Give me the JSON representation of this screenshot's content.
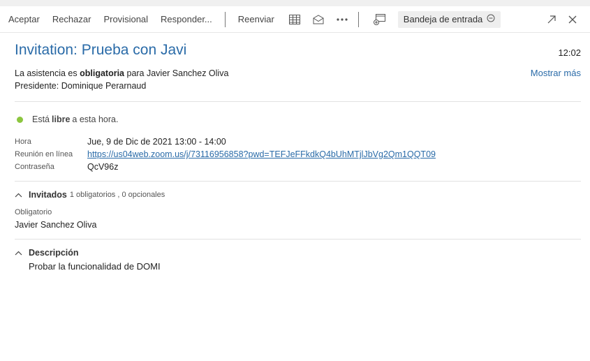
{
  "toolbar": {
    "accept": "Aceptar",
    "reject": "Rechazar",
    "tentative": "Provisional",
    "reply": "Responder...",
    "forward": "Reenviar",
    "folder": "Bandeja de entrada"
  },
  "message": {
    "title": "Invitation: Prueba con Javi",
    "time": "12:02",
    "attendance_prefix": "La asistencia es ",
    "attendance_bold": "obligatoria",
    "attendance_suffix": " para Javier Sanchez Oliva",
    "chair_label": "Presidente: ",
    "chair_name": "Dominique Perarnaud",
    "show_more": "Mostrar más"
  },
  "availability": {
    "prefix": "Está ",
    "bold": "libre",
    "suffix": " a esta hora.",
    "color": "#8cc63f"
  },
  "details": [
    {
      "label": "Hora",
      "value": "Jue, 9 de Dic de 2021 13:00 - 14:00"
    },
    {
      "label": "Reunión en línea",
      "value": "https://us04web.zoom.us/j/73116956858?pwd=TEFJeFFkdkQ4bUhMTjlJbVg2Qm1QQT09"
    },
    {
      "label": "Contraseña",
      "value": "QcV96z"
    }
  ],
  "invitees": {
    "heading": "Invitados",
    "summary": "1 obligatorios , 0 opcionales",
    "required_label": "Obligatorio",
    "required_name": "Javier Sanchez Oliva"
  },
  "description": {
    "heading": "Descripción",
    "text": "Probar la funcionalidad de DOMI"
  },
  "colors": {
    "accent": "#2a6ba8"
  }
}
